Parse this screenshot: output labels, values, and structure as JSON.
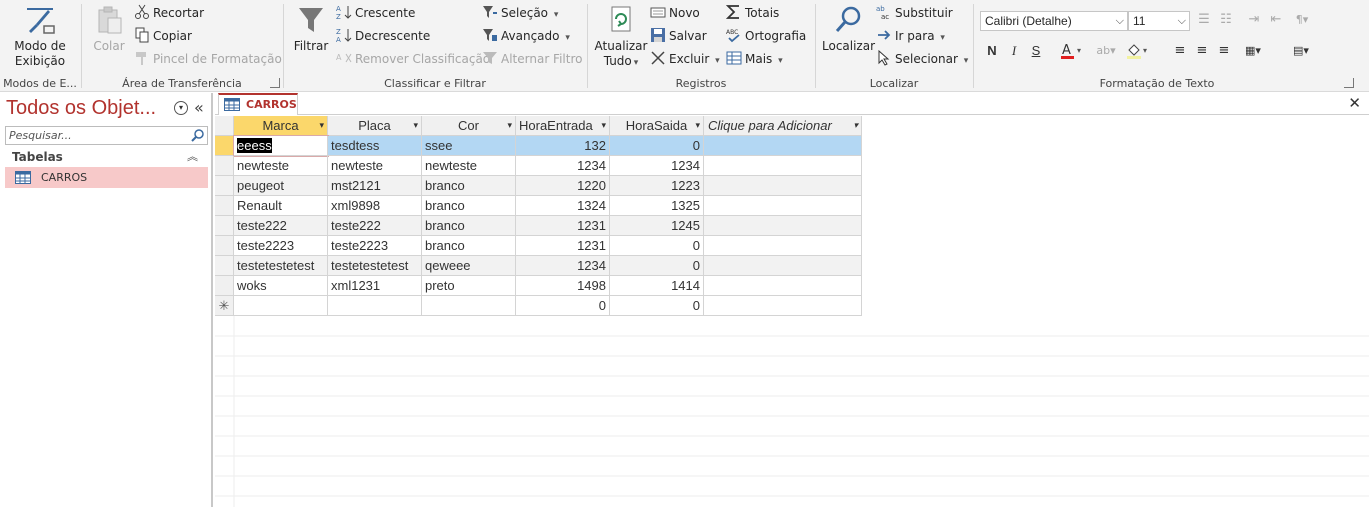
{
  "ribbon": {
    "views": {
      "button": "Modo de\nExibição",
      "group": "Modos de E..."
    },
    "clipboard": {
      "paste": "Colar",
      "cut": "Recortar",
      "copy": "Copiar",
      "format_painter": "Pincel de Formatação",
      "group": "Área de Transferência"
    },
    "sort_filter": {
      "filter": "Filtrar",
      "ascending": "Crescente",
      "descending": "Decrescente",
      "remove_sort": "Remover Classificação",
      "selection": "Seleção",
      "advanced": "Avançado",
      "toggle_filter": "Alternar Filtro",
      "group": "Classificar e Filtrar"
    },
    "records": {
      "refresh": "Atualizar\nTudo",
      "new": "Novo",
      "save": "Salvar",
      "delete": "Excluir",
      "totals": "Totais",
      "spelling": "Ortografia",
      "more": "Mais",
      "group": "Registros"
    },
    "find": {
      "find": "Localizar",
      "replace": "Substituir",
      "goto": "Ir para",
      "select": "Selecionar",
      "group": "Localizar"
    },
    "text_formatting": {
      "font": "Calibri (Detalhe)",
      "size": "11",
      "bold": "N",
      "italic": "I",
      "underline": "S",
      "group": "Formatação de Texto"
    }
  },
  "nav": {
    "title": "Todos os Objet...",
    "search_placeholder": "Pesquisar...",
    "section": "Tabelas",
    "items": [
      {
        "label": "CARROS"
      }
    ]
  },
  "document": {
    "tab": "CARROS",
    "columns": [
      "Marca",
      "Placa",
      "Cor",
      "HoraEntrada",
      "HoraSaida",
      "Clique para Adicionar"
    ],
    "rows": [
      {
        "marca": "eeess",
        "placa": "tesdtess",
        "cor": "ssee",
        "entrada": "132",
        "saida": "0"
      },
      {
        "marca": "newteste",
        "placa": "newteste",
        "cor": "newteste",
        "entrada": "1234",
        "saida": "1234"
      },
      {
        "marca": "peugeot",
        "placa": "mst2121",
        "cor": "branco",
        "entrada": "1220",
        "saida": "1223"
      },
      {
        "marca": "Renault",
        "placa": "xml9898",
        "cor": "branco",
        "entrada": "1324",
        "saida": "1325"
      },
      {
        "marca": "teste222",
        "placa": "teste222",
        "cor": "branco",
        "entrada": "1231",
        "saida": "1245"
      },
      {
        "marca": "teste2223",
        "placa": "teste2223",
        "cor": "branco",
        "entrada": "1231",
        "saida": "0"
      },
      {
        "marca": "testetestetest",
        "placa": "testetestetest",
        "cor": "qeweee",
        "entrada": "1234",
        "saida": "0"
      },
      {
        "marca": "woks",
        "placa": "xml1231",
        "cor": "preto",
        "entrada": "1498",
        "saida": "1414"
      }
    ],
    "new_row": {
      "marker": "✳",
      "entrada": "0",
      "saida": "0"
    }
  },
  "colors": {
    "accent": "#b2332e",
    "selected_row": "#b3d7f3",
    "header_selected": "#fbd76b",
    "nav_item": "#f7c9c9"
  }
}
